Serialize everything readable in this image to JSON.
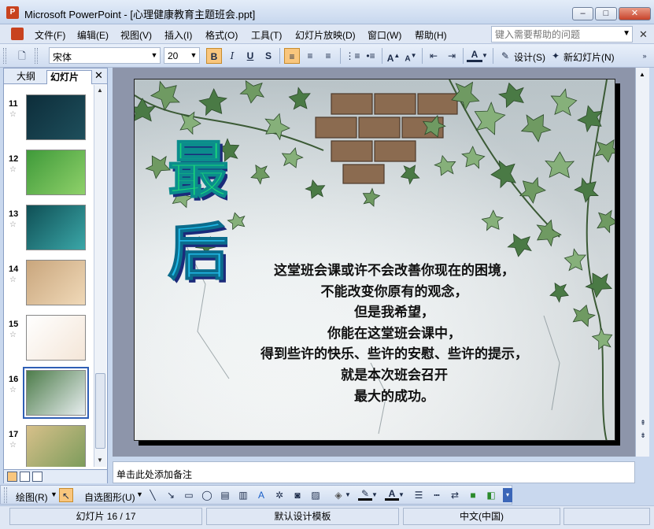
{
  "window": {
    "title": "Microsoft PowerPoint - [心理健康教育主题班会.ppt]",
    "min": "–",
    "max": "□",
    "close": "✕"
  },
  "menu": {
    "items": [
      "文件(F)",
      "编辑(E)",
      "视图(V)",
      "插入(I)",
      "格式(O)",
      "工具(T)",
      "幻灯片放映(D)",
      "窗口(W)",
      "帮助(H)"
    ],
    "help_placeholder": "键入需要帮助的问题"
  },
  "toolbar": {
    "font_name": "宋体",
    "font_size": "20",
    "bold": "B",
    "italic": "I",
    "underline": "U",
    "shadow": "S",
    "design_label": "设计(S)",
    "new_slide_label": "新幻灯片(N)"
  },
  "left_panel": {
    "tab_outline": "大纲",
    "tab_slides": "幻灯片",
    "close": "✕",
    "thumbnails": [
      {
        "number": "11",
        "colors": [
          "#0d2d3a",
          "#1e4f5c"
        ]
      },
      {
        "number": "12",
        "colors": [
          "#3f9a3a",
          "#8fd16a"
        ]
      },
      {
        "number": "13",
        "colors": [
          "#0f4f55",
          "#3ba7a8"
        ]
      },
      {
        "number": "14",
        "colors": [
          "#c9a67d",
          "#f0d9b8"
        ]
      },
      {
        "number": "15",
        "colors": [
          "#ffffff",
          "#f4e6d8"
        ]
      },
      {
        "number": "16",
        "colors": [
          "#4d7c4a",
          "#e8eef0"
        ],
        "selected": true
      },
      {
        "number": "17",
        "colors": [
          "#d7c08a",
          "#7a9b5a"
        ]
      }
    ]
  },
  "slide": {
    "wordart": [
      "最",
      "后"
    ],
    "lines": [
      "这堂班会课或许不会改善你现在的困境，",
      "不能改变你原有的观念，",
      "但是我希望，",
      "你能在这堂班会课中，",
      "得到些许的快乐、些许的安慰、些许的提示，",
      "就是本次班会召开",
      "最大的成功。"
    ]
  },
  "notes": {
    "placeholder": "单击此处添加备注"
  },
  "drawbar": {
    "draw_label": "绘图(R)",
    "autoshapes_label": "自选图形(U)"
  },
  "status": {
    "slide_info": "幻灯片 16 / 17",
    "template": "默认设计模板",
    "language": "中文(中国)"
  },
  "colors": {
    "titlebar": "#c7d7ee",
    "accent": "#f9c67d",
    "wordart_green": "#1ad67a",
    "wordart_cyan": "#20b8e6"
  }
}
